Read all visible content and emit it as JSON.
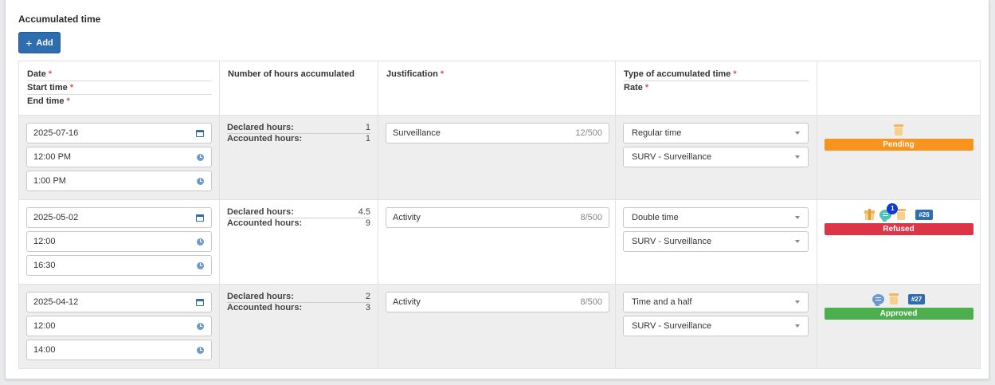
{
  "section": {
    "title": "Accumulated time",
    "add_label": "Add"
  },
  "headers": {
    "date": "Date",
    "start": "Start time",
    "end": "End time",
    "hours": "Number of hours accumulated",
    "justification": "Justification",
    "type": "Type of accumulated time",
    "rate": "Rate",
    "required_mark": "*"
  },
  "labels": {
    "declared": "Declared hours:",
    "accounted": "Accounted hours:"
  },
  "rows": [
    {
      "date": "2025-07-16",
      "start": "12:00 PM",
      "end": "1:00 PM",
      "declared": "1",
      "accounted": "1",
      "justification": "Surveillance",
      "just_count": "12/500",
      "type": "Regular time",
      "rate": "SURV - Surveillance",
      "status": "Pending",
      "status_color": "#f7941d"
    },
    {
      "date": "2025-05-02",
      "start": "12:00",
      "end": "16:30",
      "declared": "4.5",
      "accounted": "9",
      "justification": "Activity",
      "just_count": "8/500",
      "type": "Double time",
      "rate": "SURV - Surveillance",
      "comment_count": "1",
      "ref": "#26",
      "status": "Refused",
      "status_color": "#dc3545"
    },
    {
      "date": "2025-04-12",
      "start": "12:00",
      "end": "14:00",
      "declared": "2",
      "accounted": "3",
      "justification": "Activity",
      "just_count": "8/500",
      "type": "Time and a half",
      "rate": "SURV - Surveillance",
      "ref": "#27",
      "status": "Approved",
      "status_color": "#4cae4c"
    }
  ],
  "icons": {
    "date": "calendar-icon",
    "time": "clock-icon",
    "delete": "trash-icon",
    "gift": "gift-icon",
    "comment": "comment-icon",
    "select": "chevron-down-icon"
  },
  "colors": {
    "primary": "#2d6db0",
    "icon_orange": "#f4b65c",
    "comment_teal": "#4fc3b8",
    "comment_blue": "#6e9ad1"
  }
}
